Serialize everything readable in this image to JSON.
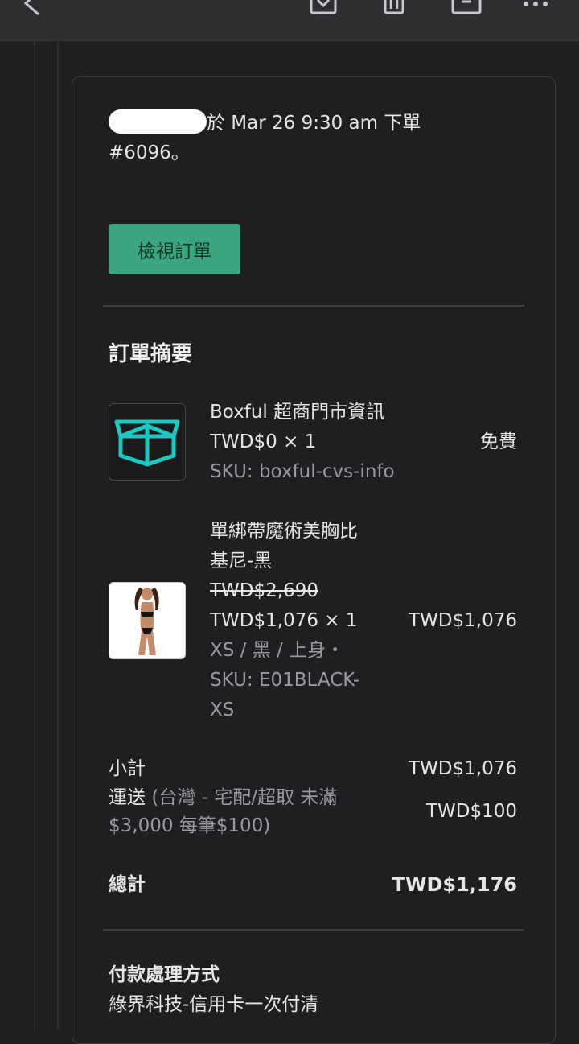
{
  "order": {
    "intro_text": "於 Mar 26 9:30 am 下單",
    "intro_number": "#6096。",
    "view_button": "檢視訂單"
  },
  "summary": {
    "title": "訂單摘要",
    "items": [
      {
        "name": "Boxful 超商門市資訊",
        "qty_price": "TWD$0 × 1",
        "sku": "SKU: boxful-cvs-info",
        "total": "免費",
        "icon": "box-icon",
        "icon_color": "#1ec8c0"
      },
      {
        "name_line1": "單綁帶魔術美胸比",
        "name_line2": "基尼-黑",
        "original_price": "TWD$2,690",
        "qty_price": "TWD$1,076 × 1",
        "variant": "XS / 黑 / 上身・",
        "sku_line1": "SKU: E01BLACK-",
        "sku_line2": "XS",
        "total": "TWD$1,076",
        "image": "bikini-product-photo"
      }
    ],
    "subtotal_label": "小計",
    "subtotal_value": "TWD$1,076",
    "shipping_label": "運送",
    "shipping_detail_line1": "(台灣 - 宅配/超取 未滿",
    "shipping_detail_line2": "$3,000 每筆$100)",
    "shipping_value": "TWD$100",
    "total_label": "總計",
    "total_value": "TWD$1,176"
  },
  "payment": {
    "title": "付款處理方式",
    "method": "綠界科技-信用卡一次付清"
  },
  "colors": {
    "background": "#1f1f21",
    "button": "#3aa57e",
    "accent_icon": "#1ec8c0"
  }
}
